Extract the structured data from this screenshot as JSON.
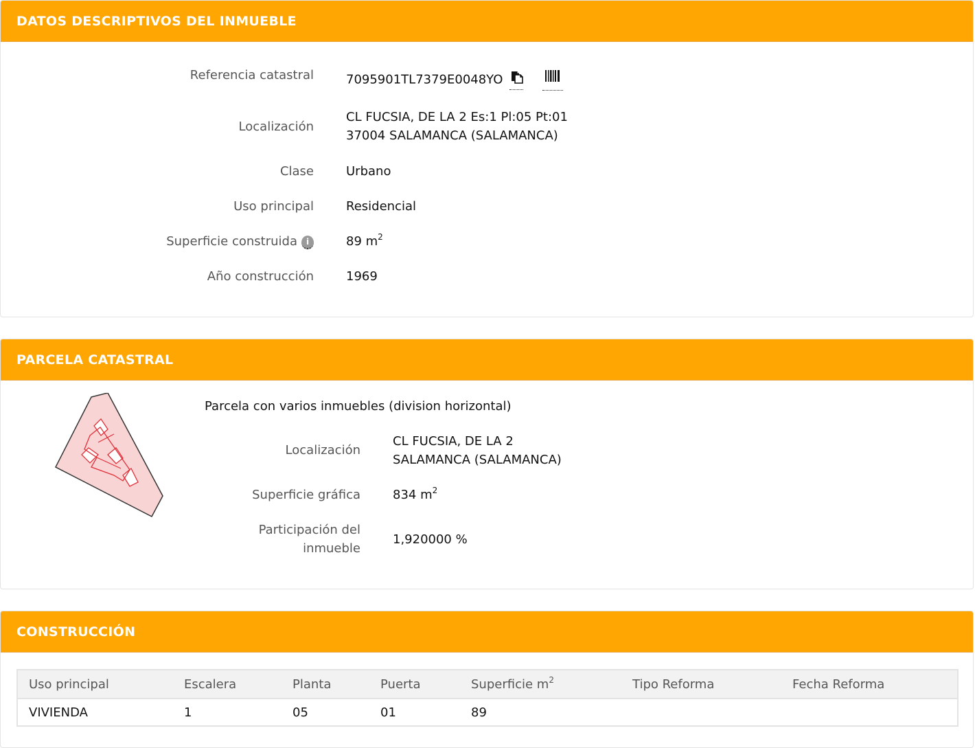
{
  "inmueble": {
    "title": "DATOS DESCRIPTIVOS DEL INMUEBLE",
    "referencia_label": "Referencia catastral",
    "referencia_value": "7095901TL7379E0048YO",
    "localizacion_label": "Localización",
    "localizacion_line1": "CL FUCSIA, DE LA 2 Es:1 Pl:05 Pt:01",
    "localizacion_line2": "37004 SALAMANCA (SALAMANCA)",
    "clase_label": "Clase",
    "clase_value": "Urbano",
    "uso_label": "Uso principal",
    "uso_value": "Residencial",
    "superficie_label": "Superficie construida",
    "superficie_value": "89 m",
    "superficie_sup": "2",
    "anio_label": "Año construcción",
    "anio_value": "1969"
  },
  "parcela": {
    "title": "PARCELA CATASTRAL",
    "description": "Parcela con varios inmuebles (division horizontal)",
    "localizacion_label": "Localización",
    "localizacion_line1": "CL FUCSIA, DE LA 2",
    "localizacion_line2": "SALAMANCA (SALAMANCA)",
    "superficie_label": "Superficie gráfica",
    "superficie_value": "834 m",
    "superficie_sup": "2",
    "participacion_label_line1": "Participación del",
    "participacion_label_line2": "inmueble",
    "participacion_value": "1,920000 %"
  },
  "construccion": {
    "title": "CONSTRUCCIÓN",
    "columns": [
      "Uso principal",
      "Escalera",
      "Planta",
      "Puerta",
      "Superficie m",
      "Tipo Reforma",
      "Fecha Reforma"
    ],
    "superficie_sup": "2",
    "rows": [
      [
        "VIVIENDA",
        "1",
        "05",
        "01",
        "89",
        "",
        ""
      ]
    ]
  },
  "colors": {
    "header_orange": "#ffa602",
    "parcel_fill": "#f9d4d4",
    "parcel_red": "#e0303a"
  },
  "icons": {
    "copy": "copy-icon",
    "barcode": "barcode-icon",
    "info": "info-icon"
  }
}
